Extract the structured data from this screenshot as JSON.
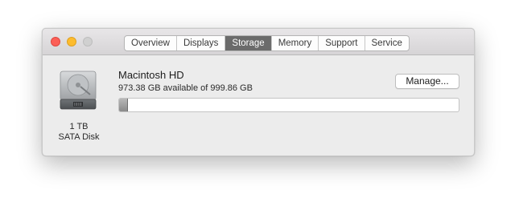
{
  "tabs": [
    {
      "label": "Overview",
      "active": false
    },
    {
      "label": "Displays",
      "active": false
    },
    {
      "label": "Storage",
      "active": true
    },
    {
      "label": "Memory",
      "active": false
    },
    {
      "label": "Support",
      "active": false
    },
    {
      "label": "Service",
      "active": false
    }
  ],
  "disk": {
    "capacity": "1 TB",
    "type": "SATA Disk",
    "icon": "hard-disk-icon"
  },
  "volume": {
    "name": "Macintosh HD",
    "availability": "973.38 GB available of 999.86 GB",
    "used_fraction": 0.0265
  },
  "manage_label": "Manage...",
  "colors": {
    "close": "#fc5f57",
    "minimize": "#fdbc2e",
    "zoom": "#d0d0d0",
    "active_tab": "#6b6b6b"
  }
}
